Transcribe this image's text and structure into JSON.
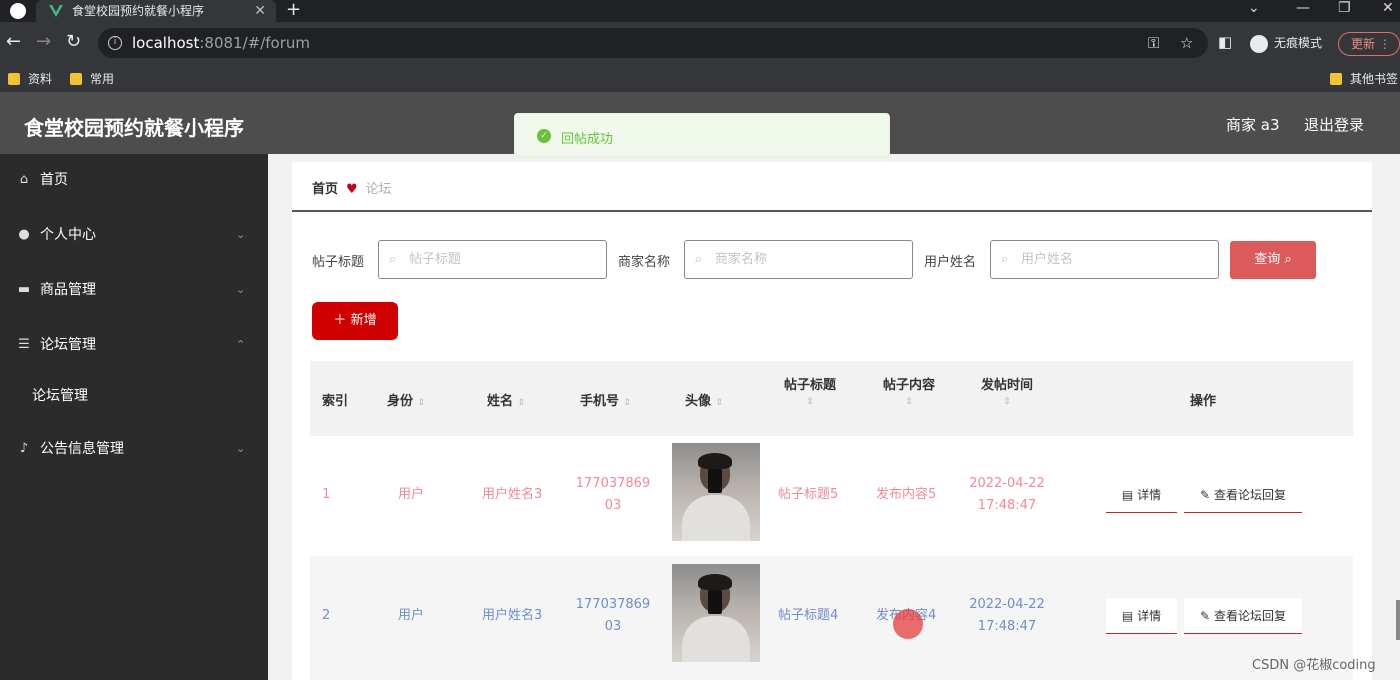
{
  "browser": {
    "tab_title": "食堂校园预约就餐小程序",
    "url_host": "localhost",
    "url_rest": ":8081/#/forum",
    "incognito_label": "无痕模式",
    "update_label": "更新",
    "bookmarks": [
      "资料",
      "常用"
    ],
    "other_bookmarks": "其他书签"
  },
  "app": {
    "title": "食堂校园预约就餐小程序",
    "user": "商家 a3",
    "logout": "退出登录"
  },
  "toast": {
    "message": "回帖成功"
  },
  "sidebar": {
    "items": [
      {
        "label": "首页",
        "icon": "home-icon"
      },
      {
        "label": "个人中心",
        "icon": "user-icon"
      },
      {
        "label": "商品管理",
        "icon": "chat-icon"
      },
      {
        "label": "论坛管理",
        "icon": "menu-icon"
      },
      {
        "label": "论坛管理",
        "icon": ""
      },
      {
        "label": "公告信息管理",
        "icon": "mic-icon"
      }
    ]
  },
  "breadcrumb": {
    "home": "首页",
    "current": "论坛"
  },
  "filters": {
    "title_label": "帖子标题",
    "title_placeholder": "帖子标题",
    "merchant_label": "商家名称",
    "merchant_placeholder": "商家名称",
    "username_label": "用户姓名",
    "username_placeholder": "用户姓名",
    "query_button": "查询"
  },
  "add_button": "新增",
  "table": {
    "headers": [
      "索引",
      "身份",
      "姓名",
      "手机号",
      "头像",
      "帖子标题",
      "帖子内容",
      "发帖时间",
      "操作"
    ],
    "rows": [
      {
        "index": "1",
        "role": "用户",
        "name": "用户姓名3",
        "phone_a": "177037869",
        "phone_b": "03",
        "title": "帖子标题5",
        "content": "发布内容5",
        "date": "2022-04-22",
        "time": "17:48:47"
      },
      {
        "index": "2",
        "role": "用户",
        "name": "用户姓名3",
        "phone_a": "177037869",
        "phone_b": "03",
        "title": "帖子标题4",
        "content": "发布内容4",
        "date": "2022-04-22",
        "time": "17:48:47"
      }
    ],
    "actions": {
      "detail": "详情",
      "view_replies": "查看论坛回复"
    }
  },
  "colors": {
    "row1_text": "#f08a9a",
    "row2_text": "#6f8fc4",
    "accent": "#d10000"
  },
  "watermark": "CSDN @花椒coding"
}
